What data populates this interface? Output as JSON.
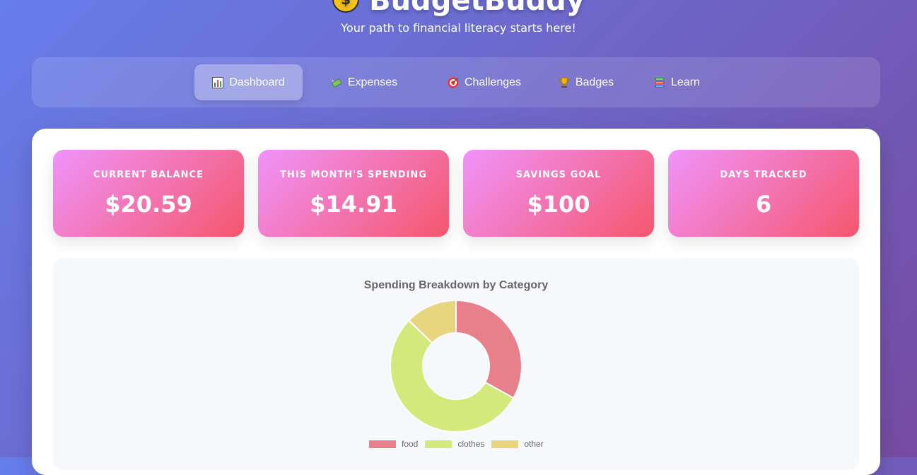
{
  "app": {
    "title": "BudgetBuddy",
    "logo_icon": "money-bag-icon",
    "tagline": "Your path to financial literacy starts here!"
  },
  "nav": {
    "tabs": [
      {
        "label": "Dashboard",
        "icon": "bar-chart-icon",
        "active": true
      },
      {
        "label": "Expenses",
        "icon": "money-wings-icon",
        "active": false
      },
      {
        "label": "Challenges",
        "icon": "target-icon",
        "active": false
      },
      {
        "label": "Badges",
        "icon": "trophy-icon",
        "active": false
      },
      {
        "label": "Learn",
        "icon": "books-icon",
        "active": false
      }
    ]
  },
  "stats": [
    {
      "label": "Current Balance",
      "value": "$20.59"
    },
    {
      "label": "This Month's Spending",
      "value": "$14.91"
    },
    {
      "label": "Savings Goal",
      "value": "$100"
    },
    {
      "label": "Days Tracked",
      "value": "6"
    }
  ],
  "colors": {
    "stat_gradient": [
      "#f093fb",
      "#f5576c"
    ],
    "background_gradient": [
      "#667eea",
      "#764ba2"
    ]
  },
  "chart_data": {
    "type": "pie",
    "title": "Spending Breakdown by Category",
    "categories": [
      "food",
      "clothes",
      "other"
    ],
    "values": [
      4.93,
      8.08,
      1.9
    ],
    "colors": [
      "#e8808c",
      "#d3e97c",
      "#e8d67e"
    ],
    "donut": true,
    "legend": "bottom"
  }
}
